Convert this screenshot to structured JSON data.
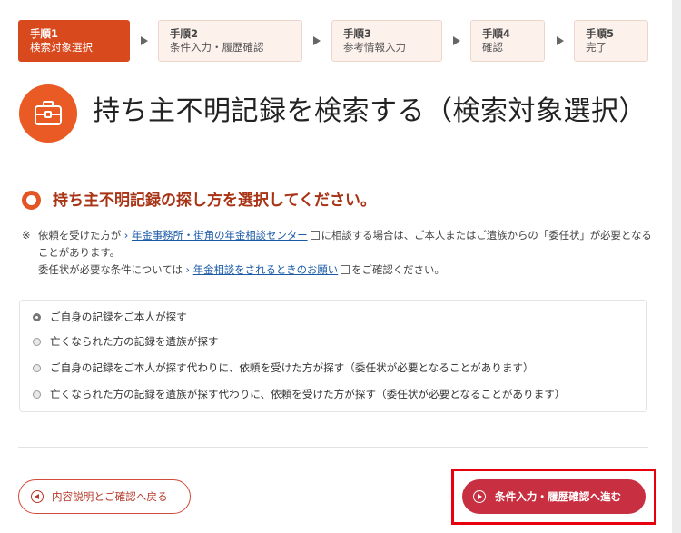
{
  "stepper": {
    "steps": [
      {
        "num": "手順1",
        "label": "検索対象選択",
        "active": true
      },
      {
        "num": "手順2",
        "label": "条件入力・履歴確認",
        "active": false
      },
      {
        "num": "手順3",
        "label": "参考情報入力",
        "active": false
      },
      {
        "num": "手順4",
        "label": "確認",
        "active": false
      },
      {
        "num": "手順5",
        "label": "完了",
        "active": false
      }
    ]
  },
  "header": {
    "icon": "toolbox-icon",
    "title": "持ち主不明記録を検索する（検索対象選択）"
  },
  "section": {
    "title": "持ち主不明記録の探し方を選択してください。"
  },
  "note": {
    "mark": "※",
    "line1_before": "依頼を受けた方が",
    "link1": "年金事務所・街角の年金相談センター",
    "line1_after": "に相談する場合は、ご本人またはご遺族からの「委任状」が必要となることがあります。",
    "line2_before": "委任状が必要な条件については",
    "link2": "年金相談をされるときのお願い",
    "line2_after": "をご確認ください。"
  },
  "options": [
    {
      "label": "ご自身の記録をご本人が探す",
      "checked": true
    },
    {
      "label": "亡くなられた方の記録を遺族が探す",
      "checked": false
    },
    {
      "label": "ご自身の記録をご本人が探す代わりに、依頼を受けた方が探す（委任状が必要となることがあります）",
      "checked": false
    },
    {
      "label": "亡くなられた方の記録を遺族が探す代わりに、依頼を受けた方が探す（委任状が必要となることがあります）",
      "checked": false
    }
  ],
  "buttons": {
    "back_label": "内容説明とご確認へ戻る",
    "next_label": "条件入力・履歴確認へ進む"
  },
  "colors": {
    "accent": "#ea5a24",
    "active_step": "#d9491e",
    "next_button": "#c83042",
    "highlight_frame": "#e8000e",
    "link": "#1a5aa6"
  }
}
